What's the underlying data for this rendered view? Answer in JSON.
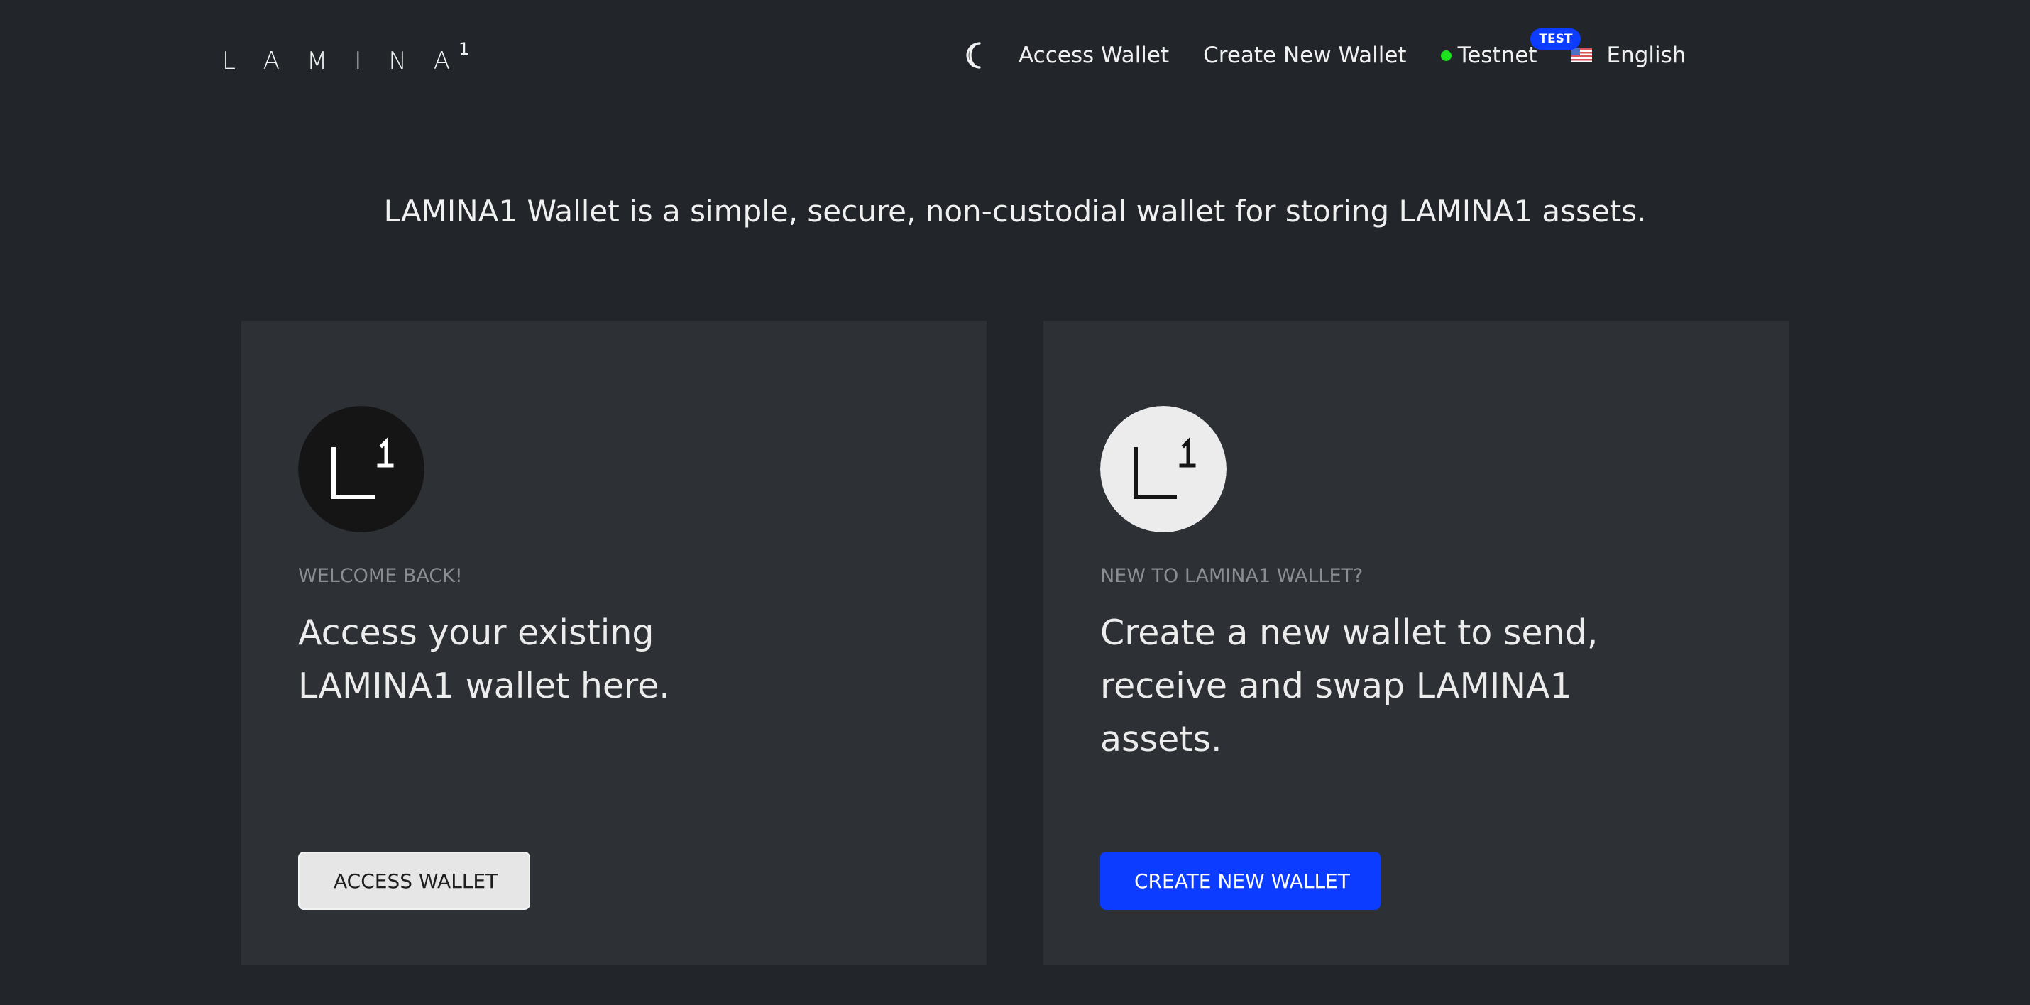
{
  "header": {
    "logo": {
      "word": "LAMINA",
      "superscript": "1"
    },
    "theme_toggle_icon": "moon-icon",
    "nav": {
      "access_wallet": "Access Wallet",
      "create_new_wallet": "Create New Wallet"
    },
    "network": {
      "label": "Testnet",
      "badge": "TEST",
      "status_color": "#1fe01f"
    },
    "language": {
      "flag_icon": "us-flag-icon",
      "label": "English"
    }
  },
  "tagline": "LAMINA1 Wallet is a simple, secure, non-custodial wallet for storing LAMINA1 assets.",
  "cards": {
    "access": {
      "avatar_icon": "lamina1-dark-logo-icon",
      "eyebrow": "WELCOME BACK!",
      "description": "Access your existing LAMINA1 wallet here.",
      "button": "ACCESS WALLET"
    },
    "create": {
      "avatar_icon": "lamina1-light-logo-icon",
      "eyebrow": "NEW TO LAMINA1 WALLET?",
      "description": "Create a new wallet to send, receive and swap LAMINA1 assets.",
      "button": "CREATE NEW WALLET"
    }
  },
  "colors": {
    "background": "#22262a",
    "card": "#2d3135",
    "accent": "#0b3cff"
  }
}
